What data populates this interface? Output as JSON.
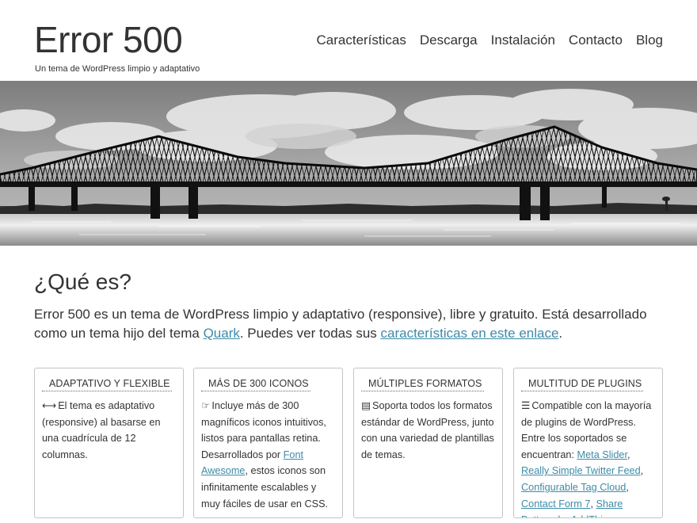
{
  "header": {
    "title": "Error 500",
    "tagline": "Un tema de WordPress limpio y adaptativo"
  },
  "nav": [
    "Características",
    "Descarga",
    "Instalación",
    "Contacto",
    "Blog"
  ],
  "about": {
    "title": "¿Qué es?",
    "text_1": "Error 500 es un tema de WordPress limpio y adaptativo (responsive), libre y gratuito. Está desarrollado como un tema hijo del tema ",
    "link_quark": "Quark",
    "text_2": ". Puedes ver todas sus ",
    "link_features": "características en este enlace",
    "text_3": "."
  },
  "features": [
    {
      "title": "Adaptativo y flexible",
      "icon": "arrows-h-icon",
      "glyph": "⟷",
      "text": "El tema es adaptativo (responsive) al basarse en una cuadrícula de 12 columnas."
    },
    {
      "title": "Más de 300 iconos",
      "icon": "hand-pointing-icon",
      "glyph": "☞",
      "text_1": "Incluye más de 300 magníficos iconos intuitivos, listos para pantallas retina. Desarrollados por ",
      "link": "Font Awesome",
      "text_2": ", estos iconos son infinitamente escalables y muy fáciles de usar en CSS."
    },
    {
      "title": "Múltiples formatos",
      "icon": "document-icon",
      "glyph": "▤",
      "text": "Soporta todos los formatos estándar de WordPress, junto con una variedad de plantillas de temas."
    },
    {
      "title": "Multitud de plugins",
      "icon": "list-icon",
      "glyph": "☰",
      "text_1": "Compatible con la mayoría de plugins de WordPress. Entre los soportados se encuentran: ",
      "links": [
        "Meta Slider",
        "Really Simple Twitter Feed",
        "Configurable Tag Cloud",
        "Contact Form 7",
        "Share Buttons by AddThis"
      ],
      "sep": ", ",
      "end": "."
    }
  ],
  "colors": {
    "link": "#3d8ba8",
    "text": "#333333",
    "card_border": "#c4c4c4"
  }
}
